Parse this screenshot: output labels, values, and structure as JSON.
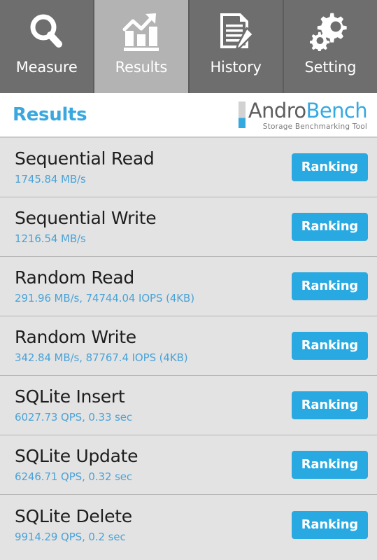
{
  "tabs": [
    {
      "label": "Measure",
      "icon": "magnifier-icon",
      "active": false
    },
    {
      "label": "Results",
      "icon": "bar-chart-icon",
      "active": true
    },
    {
      "label": "History",
      "icon": "document-pencil-icon",
      "active": false
    },
    {
      "label": "Setting",
      "icon": "gears-icon",
      "active": false
    }
  ],
  "header": {
    "title": "Results",
    "logo_primary": "Andro",
    "logo_secondary": "Bench",
    "logo_subtitle": "Storage Benchmarking Tool"
  },
  "colors": {
    "accent_blue": "#29a9e1",
    "value_blue": "#4aa3d8",
    "tab_inactive": "#6e6e6e",
    "tab_active": "#b3b3b3",
    "row_background": "#e3e3e3",
    "logo_gray": "#5e5e5e"
  },
  "results": [
    {
      "name": "Sequential Read",
      "value": "1745.84 MB/s",
      "button": "Ranking"
    },
    {
      "name": "Sequential Write",
      "value": "1216.54 MB/s",
      "button": "Ranking"
    },
    {
      "name": "Random Read",
      "value": "291.96 MB/s, 74744.04 IOPS (4KB)",
      "button": "Ranking"
    },
    {
      "name": "Random Write",
      "value": "342.84 MB/s, 87767.4 IOPS (4KB)",
      "button": "Ranking"
    },
    {
      "name": "SQLite Insert",
      "value": "6027.73 QPS, 0.33 sec",
      "button": "Ranking"
    },
    {
      "name": "SQLite Update",
      "value": "6246.71 QPS, 0.32 sec",
      "button": "Ranking"
    },
    {
      "name": "SQLite Delete",
      "value": "9914.29 QPS, 0.2 sec",
      "button": "Ranking"
    }
  ]
}
